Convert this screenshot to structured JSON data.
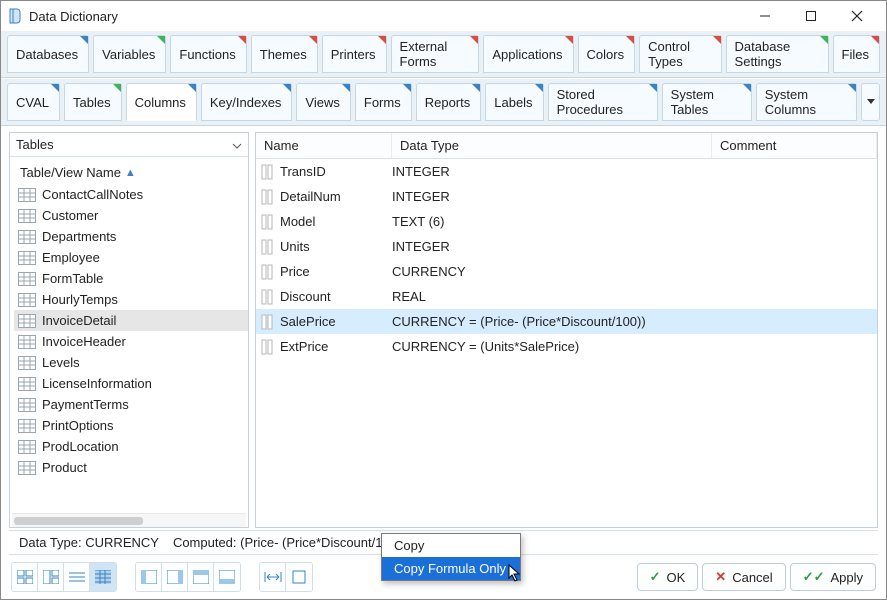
{
  "window": {
    "title": "Data Dictionary"
  },
  "tabs1": [
    {
      "label": "Databases",
      "corner": "blue"
    },
    {
      "label": "Variables",
      "corner": "green"
    },
    {
      "label": "Functions",
      "corner": "red"
    },
    {
      "label": "Themes",
      "corner": "red"
    },
    {
      "label": "Printers",
      "corner": "red"
    },
    {
      "label": "External Forms",
      "corner": "red"
    },
    {
      "label": "Applications",
      "corner": "red"
    },
    {
      "label": "Colors",
      "corner": "red"
    },
    {
      "label": "Control Types",
      "corner": "red"
    },
    {
      "label": "Database Settings",
      "corner": "green"
    },
    {
      "label": "Files",
      "corner": "red"
    }
  ],
  "tabs2": [
    {
      "label": "CVAL",
      "corner": "blue"
    },
    {
      "label": "Tables",
      "corner": "green"
    },
    {
      "label": "Columns",
      "corner": "blue",
      "active": true
    },
    {
      "label": "Key/Indexes",
      "corner": "blue"
    },
    {
      "label": "Views",
      "corner": "blue"
    },
    {
      "label": "Forms",
      "corner": "blue"
    },
    {
      "label": "Reports",
      "corner": "blue"
    },
    {
      "label": "Labels",
      "corner": "blue"
    },
    {
      "label": "Stored Procedures",
      "corner": "blue"
    },
    {
      "label": "System Tables",
      "corner": "blue"
    },
    {
      "label": "System Columns",
      "corner": "blue"
    }
  ],
  "leftHeader": "Tables",
  "treeHeader": "Table/View Name",
  "tables": [
    {
      "name": "ContactCallNotes"
    },
    {
      "name": "Customer"
    },
    {
      "name": "Departments"
    },
    {
      "name": "Employee"
    },
    {
      "name": "FormTable"
    },
    {
      "name": "HourlyTemps"
    },
    {
      "name": "InvoiceDetail",
      "selected": true
    },
    {
      "name": "InvoiceHeader"
    },
    {
      "name": "Levels"
    },
    {
      "name": "LicenseInformation"
    },
    {
      "name": "PaymentTerms"
    },
    {
      "name": "PrintOptions"
    },
    {
      "name": "ProdLocation"
    },
    {
      "name": "Product"
    }
  ],
  "colHeaders": {
    "name": "Name",
    "datatype": "Data Type",
    "comment": "Comment"
  },
  "rows": [
    {
      "name": "TransID",
      "dt": "INTEGER"
    },
    {
      "name": "DetailNum",
      "dt": "INTEGER"
    },
    {
      "name": "Model",
      "dt": "TEXT (6)"
    },
    {
      "name": "Units",
      "dt": "INTEGER"
    },
    {
      "name": "Price",
      "dt": "CURRENCY"
    },
    {
      "name": "Discount",
      "dt": "REAL"
    },
    {
      "name": "SalePrice",
      "dt": "CURRENCY =  (Price- (Price*Discount/100))",
      "selected": true
    },
    {
      "name": "ExtPrice",
      "dt": "CURRENCY =  (Units*SalePrice)"
    }
  ],
  "status": {
    "label1": "Data Type:",
    "val1": "CURRENCY",
    "label2": "Computed:",
    "val2": "(Price- (Price*Discount/100))"
  },
  "contextMenu": {
    "copy": "Copy",
    "copyFormula": "Copy Formula Only"
  },
  "buttons": {
    "ok": "OK",
    "cancel": "Cancel",
    "apply": "Apply"
  }
}
